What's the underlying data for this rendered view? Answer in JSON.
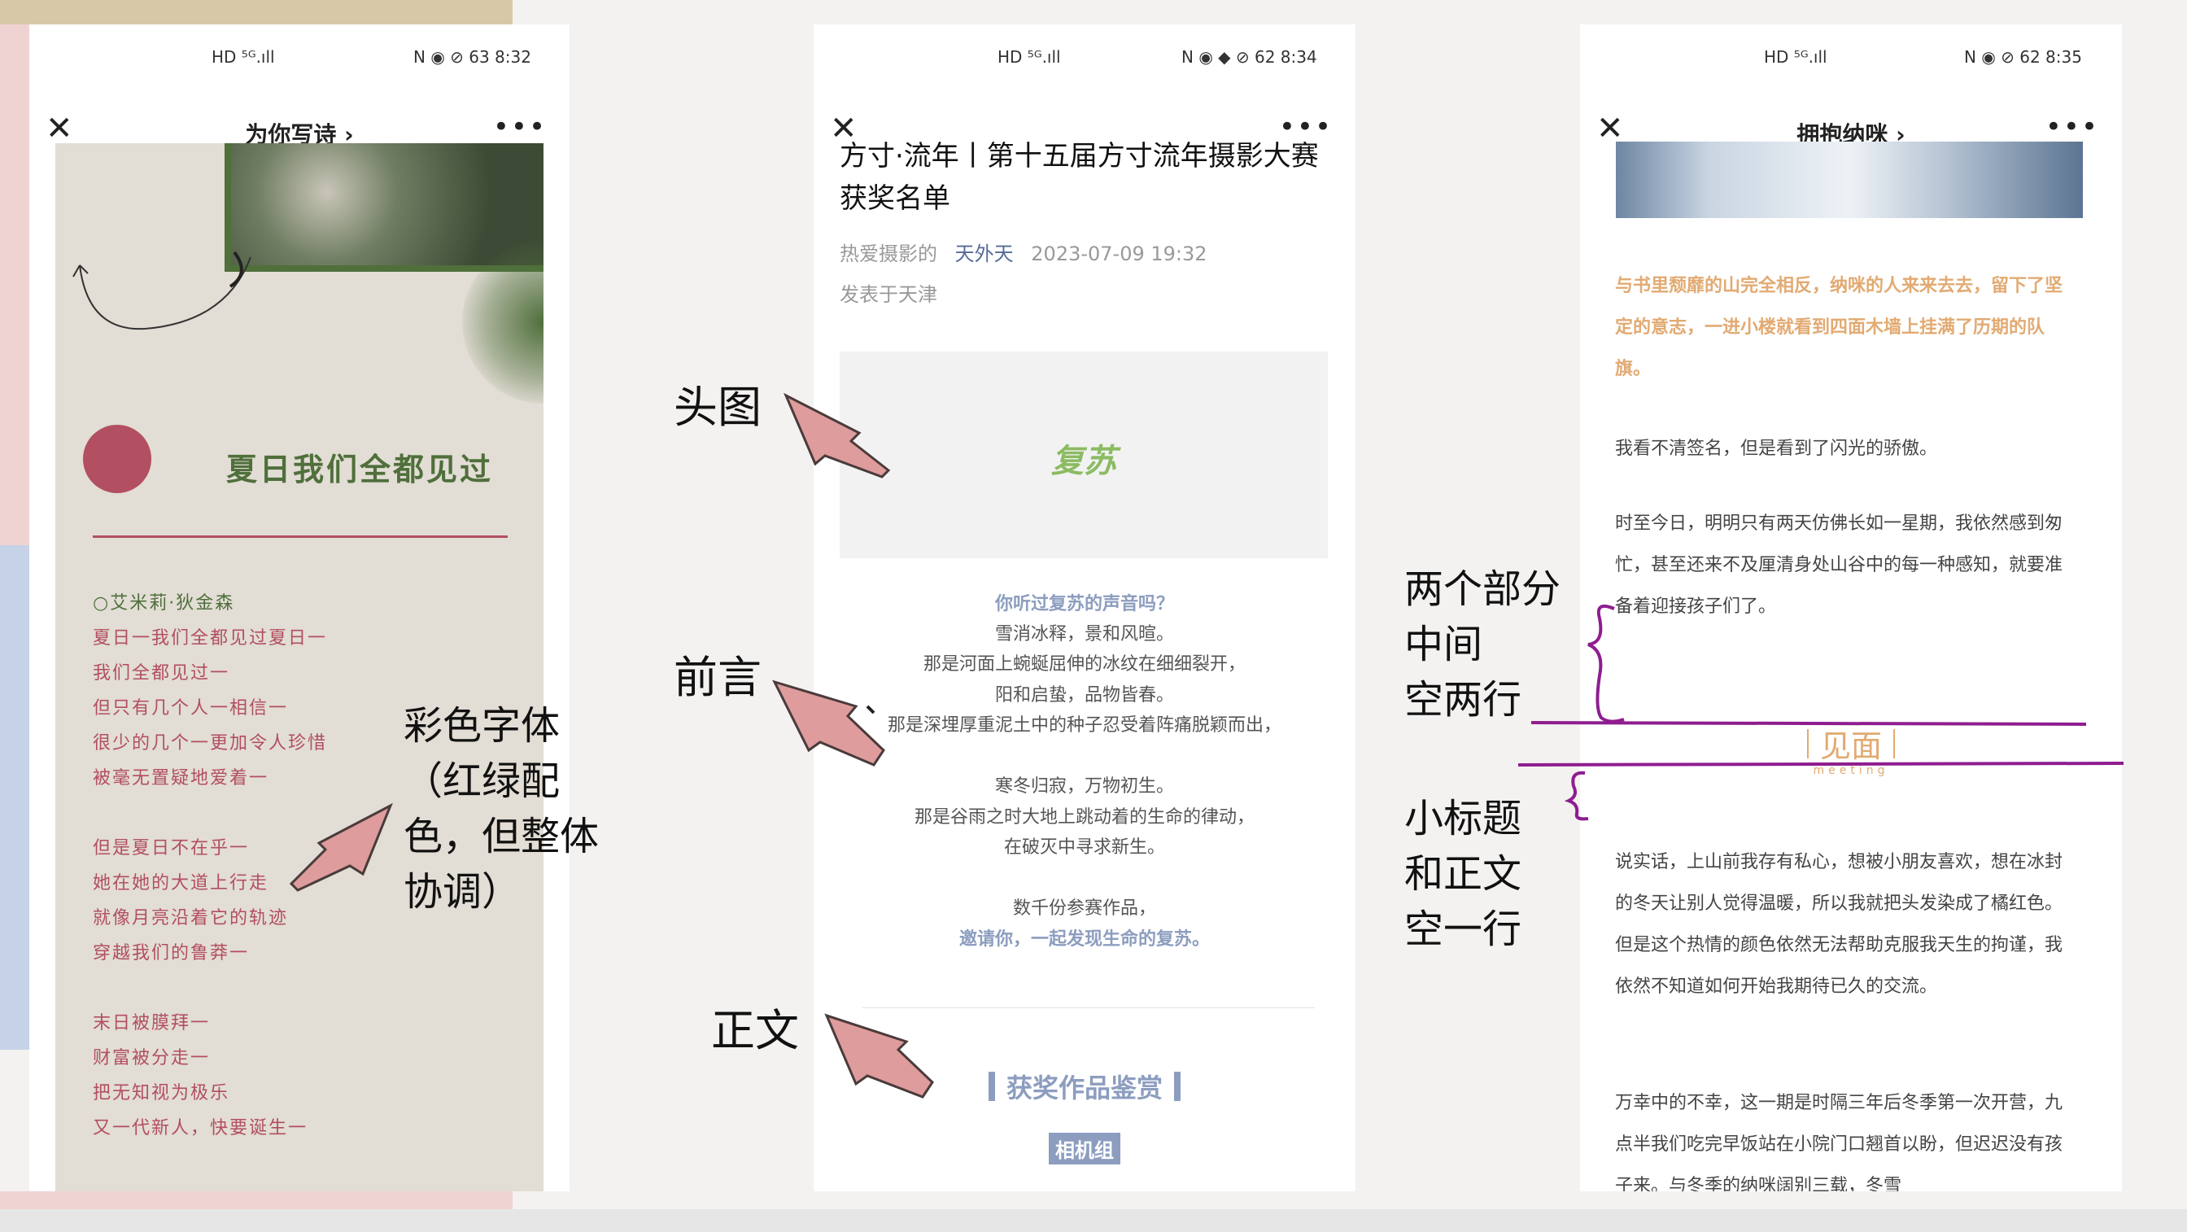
{
  "colors": {
    "poem_red": "#b24f60",
    "poem_green": "#4f6f3b",
    "poem_bg": "#e2ddd5",
    "accent_blue": "#8c9dbf",
    "accent_orange": "#e2aa72",
    "marker_purple": "#8e1d8f",
    "arrow_pink": "#df9c9c"
  },
  "phone1": {
    "status_left": "HD ⁵ᴳ.ıll",
    "status_right": "N ◉ ⊘ 63 8:32",
    "nav_title": "为你写诗 ›",
    "heading": "夏日我们全都见过",
    "author": "○艾米莉·狄金森",
    "stanzas": [
      [
        "夏日一我们全都见过夏日一",
        "我们全都见过一",
        "但只有几个人一相信一",
        "很少的几个一更加令人珍惜",
        "被毫无置疑地爱着一"
      ],
      [
        "但是夏日不在乎一",
        "她在她的大道上行走",
        "就像月亮沿着它的轨迹",
        "穿越我们的鲁莽一"
      ],
      [
        "末日被膜拜一",
        "财富被分走一",
        "把无知视为极乐",
        "又一代新人，快要诞生一"
      ]
    ]
  },
  "phone2": {
    "status_left": "HD ⁵ᴳ.ıll",
    "status_right": "N ◉ ◆ ⊘ 62 8:34",
    "title": "方寸·流年丨第十五届方寸流年摄影大赛获奖名单",
    "source": "热爱摄影的",
    "account": "天外天",
    "date": "2023-07-09 19:32",
    "location": "发表于天津",
    "logo": "复苏",
    "intro_question": "你听过复苏的声音吗？",
    "intro_lines": [
      "雪消冰释，景和风暄。",
      "那是河面上蜿蜒屈伸的冰纹在细细裂开，",
      "阳和启蛰，品物皆春。",
      "那是深埋厚重泥土中的种子忍受着阵痛脱颖而出，",
      "寒冬归寂，万物初生。",
      "那是谷雨之时大地上跳动着的生命的律动，",
      "在破灭中寻求新生。"
    ],
    "intro_count": "数千份参赛作品，",
    "intro_invite": "邀请你，一起发现生命的复苏。",
    "section_heading": "获奖作品鉴赏",
    "tag": "相机组"
  },
  "phone3": {
    "status_left": "HD ⁵ᴳ.ıll",
    "status_right": "N ◉ ⊘ 62 8:35",
    "nav_title": "拥抱纳咪 ›",
    "quote": "与书里颓靡的山完全相反，纳咪的人来来去去，留下了坚定的意志，一进小楼就看到四面木墙上挂满了历期的队旗。",
    "para1": "我看不清签名，但是看到了闪光的骄傲。",
    "para2": "时至今日，明明只有两天仿佛长如一星期，我依然感到匆忙，甚至还来不及厘清身处山谷中的每一种感知，就要准备着迎接孩子们了。",
    "subtitle": "见面",
    "subtitle_en": "meeting",
    "para3": "说实话，上山前我存有私心，想被小朋友喜欢，想在冰封的冬天让别人觉得温暖，所以我就把头发染成了橘红色。但是这个热情的颜色依然无法帮助克服我天生的拘谨，我依然不知道如何开始我期待已久的交流。",
    "para4": "万幸中的不幸，这一期是时隔三年后冬季第一次开营，九点半我们吃完早饭站在小院门口翘首以盼，但迟迟没有孩子来。与冬季的纳咪阔别三载，冬雪"
  },
  "annotations": {
    "color_font": [
      "彩色字体",
      "（红绿配",
      "色，但整体",
      "协调）"
    ],
    "head_image": "头图",
    "preface": "前言",
    "body_text": "正文",
    "two_parts": [
      "两个部分",
      "中间",
      "空两行"
    ],
    "subtitle_body": [
      "小标题",
      "和正文",
      "空一行"
    ]
  }
}
